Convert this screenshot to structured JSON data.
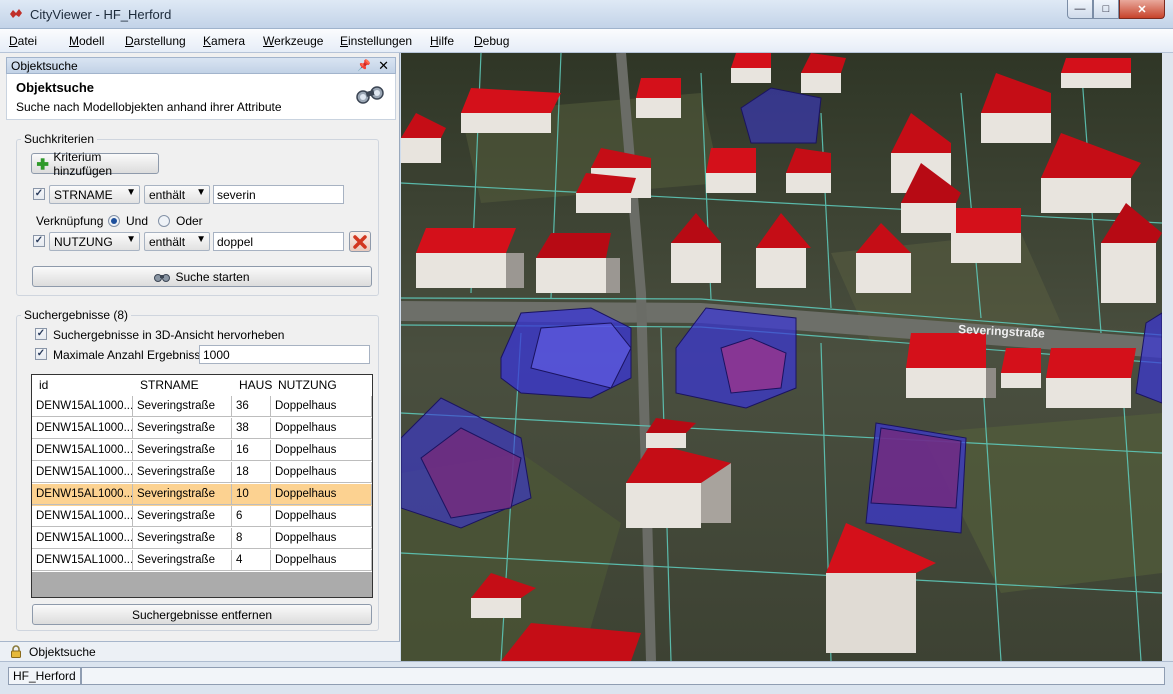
{
  "window": {
    "title": "CityViewer - HF_Herford",
    "minimize_glyph": "—",
    "maximize_glyph": "□",
    "close_glyph": "✕"
  },
  "menu": [
    {
      "u": "D",
      "rest": "atei"
    },
    {
      "u": "M",
      "rest": "odell"
    },
    {
      "u": "D",
      "rest": "arstellung"
    },
    {
      "u": "K",
      "rest": "amera"
    },
    {
      "u": "W",
      "rest": "erkzeuge"
    },
    {
      "u": "E",
      "rest": "instellungen"
    },
    {
      "u": "H",
      "rest": "ilfe"
    },
    {
      "u": "D",
      "rest": "ebug"
    }
  ],
  "panel": {
    "header": "Objektsuche",
    "pin_glyph": "📌",
    "close_glyph": "✕",
    "title": "Objektsuche",
    "subtitle": "Suche nach Modellobjekten anhand ihrer Attribute"
  },
  "criteria": {
    "legend": "Suchkriterien",
    "add_button": "Kriterium hinzufügen",
    "row1": {
      "checked": "✓",
      "field": "STRNAME",
      "operator": "enthält",
      "value": "severin"
    },
    "link_label": "Verknüpfung",
    "link_and": "Und",
    "link_or": "Oder",
    "row2": {
      "checked": "✓",
      "field": "NUTZUNG",
      "operator": "enthält",
      "value": "doppel"
    },
    "dropdown_arrow": "▼",
    "start_button": "Suche starten"
  },
  "results": {
    "legend": "Suchergebnisse (8)",
    "highlight_label": "Suchergebnisse in 3D-Ansicht hervorheben",
    "highlight_checked": "✓",
    "max_label": "Maximale Anzahl Ergebnisse",
    "max_checked": "✓",
    "max_value": "1000",
    "columns": [
      "id",
      "STRNAME",
      "HAUS",
      "NUTZUNG"
    ],
    "rows": [
      [
        "DENW15AL1000...",
        "Severingstraße",
        "36",
        "Doppelhaus"
      ],
      [
        "DENW15AL1000...",
        "Severingstraße",
        "38",
        "Doppelhaus"
      ],
      [
        "DENW15AL1000...",
        "Severingstraße",
        "16",
        "Doppelhaus"
      ],
      [
        "DENW15AL1000...",
        "Severingstraße",
        "18",
        "Doppelhaus"
      ],
      [
        "DENW15AL1000...",
        "Severingstraße",
        "10",
        "Doppelhaus"
      ],
      [
        "DENW15AL1000...",
        "Severingstraße",
        "6",
        "Doppelhaus"
      ],
      [
        "DENW15AL1000...",
        "Severingstraße",
        "8",
        "Doppelhaus"
      ],
      [
        "DENW15AL1000...",
        "Severingstraße",
        "4",
        "Doppelhaus"
      ]
    ],
    "selected_index": 4,
    "clear_button": "Suchergebnisse entfernen"
  },
  "dock_tab": "Objektsuche",
  "view": {
    "street_label": "Severingstraße",
    "roof_color": "#d4101a",
    "highlight_color": "#3a36d8"
  },
  "status": {
    "model": "HF_Herford"
  }
}
